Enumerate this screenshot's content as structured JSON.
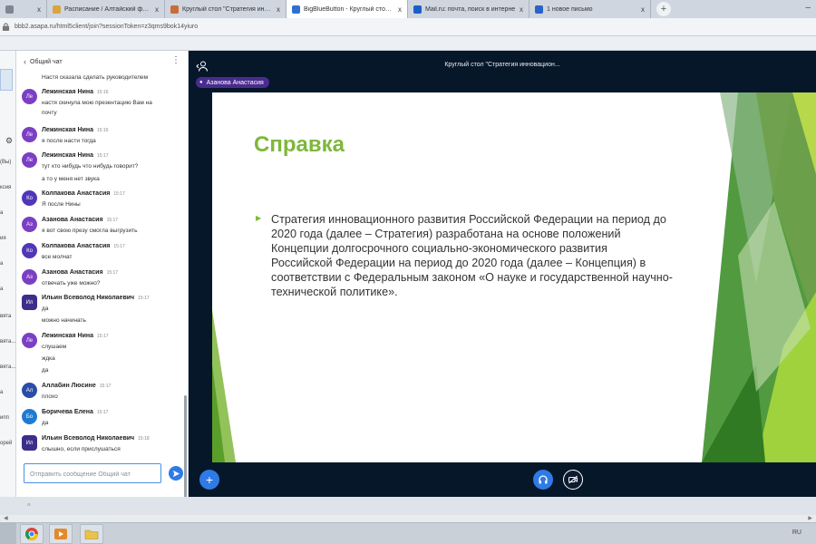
{
  "browser": {
    "tabs": [
      {
        "title": "",
        "color": "#7c8796",
        "active": false
      },
      {
        "title": "Расписание / Алтайский филиал",
        "color": "#d9a441",
        "active": false
      },
      {
        "title": "Круглый стол \"Стратегия иннова",
        "color": "#c96b3a",
        "active": false
      },
      {
        "title": "BigBlueButton - Круглый стол \"С",
        "color": "#2f6fd1",
        "active": true
      },
      {
        "title": "Mail.ru: почта, поиск в интерне",
        "color": "#1a5fc9",
        "active": false
      },
      {
        "title": "1 новое письмо",
        "color": "#2a63c8",
        "active": false
      }
    ],
    "tab_close": "x",
    "new_tab": "+",
    "window_controls": "–",
    "url": "bbb2.asapa.ru/html5client/join?sessionToken=z3qms9bok14yiuro"
  },
  "userlist": {
    "fragments": [
      "⚙",
      "(Вы)",
      "ксия",
      "а",
      "ия",
      "а",
      "а",
      "вята",
      "вята...",
      "вята...",
      "а",
      "ипп",
      "орей"
    ]
  },
  "chat": {
    "header": "Общий чат",
    "back_icon": "‹",
    "menu_icon": "⋮",
    "messages": [
      {
        "initials": "",
        "name": "",
        "time": "",
        "lines": [
          "Настя сказала сделать руководителем"
        ],
        "color": "#7b3fc4"
      },
      {
        "initials": "Ле",
        "name": "Лежинская Нина",
        "time": "15:16",
        "lines": [
          "настя скинула мою презентацию Вам на",
          "почту"
        ],
        "color": "#7b3fc4"
      },
      {
        "initials": "Ле",
        "name": "Лежинская Нина",
        "time": "15:16",
        "lines": [
          "я после насти тогда"
        ],
        "color": "#7b3fc4"
      },
      {
        "initials": "Ле",
        "name": "Лежинская Нина",
        "time": "15:17",
        "lines": [
          "тут кто нибудь что нибудь говорит?",
          "а то у меня нет звука"
        ],
        "color": "#7b3fc4"
      },
      {
        "initials": "Ко",
        "name": "Колпакова Анастасия",
        "time": "15:17",
        "lines": [
          "Я после Нины"
        ],
        "color": "#5236b8"
      },
      {
        "initials": "Аз",
        "name": "Азанова Анастасия",
        "time": "15:17",
        "lines": [
          "я вот свою презу смогла выгрузить"
        ],
        "color": "#7b3fc4"
      },
      {
        "initials": "Ко",
        "name": "Колпакова Анастасия",
        "time": "15:17",
        "lines": [
          "все молчат"
        ],
        "color": "#5236b8"
      },
      {
        "initials": "Аз",
        "name": "Азанова Анастасия",
        "time": "15:17",
        "lines": [
          "отвечать уже можно?"
        ],
        "color": "#7b3fc4"
      },
      {
        "initials": "Ил",
        "name": "Ильин Всеволод Николаевич",
        "time": "15:17",
        "lines": [
          "да",
          "можно начинать"
        ],
        "color": "#3b2f8a"
      },
      {
        "initials": "Ле",
        "name": "Лежинская Нина",
        "time": "15:17",
        "lines": [
          "слушаем",
          "ждка",
          "да"
        ],
        "color": "#7b3fc4"
      },
      {
        "initials": "Ал",
        "name": "Аллабин Люсине",
        "time": "15:17",
        "lines": [
          "плохо"
        ],
        "color": "#2a4da8"
      },
      {
        "initials": "Бо",
        "name": "Боричева Елена",
        "time": "15:17",
        "lines": [
          "да"
        ],
        "color": "#1f7bd1"
      },
      {
        "initials": "Ил",
        "name": "Ильин Всеволод Николаевич",
        "time": "15:18",
        "lines": [
          "слышно, если прислушаться"
        ],
        "color": "#3b2f8a"
      }
    ],
    "input_placeholder": "Отправить сообщение Общий чат"
  },
  "main": {
    "title": "Круглый стол \"Стратегия инновацион...",
    "talker": "Азанова Анастасия",
    "mic_icon": "●",
    "plus": "+",
    "slide": {
      "title": "Справка",
      "bullet": "▶",
      "text": "Стратегия инновационного развития Российской Федерации на период до\n2020 года (далее – Стратегия) разработана на основе положений\nКонцепции долгосрочного социально-экономического развития\nРоссийской Федерации на период до 2020 года (далее – Концепция) в\nсоответствии с Федеральным законом «О науке и государственной научно-\nтехнической политике».",
      "accent_color": "#7fb73c"
    }
  },
  "app_bottom": {
    "indicator": "^",
    "scroll_left": "◀",
    "scroll_right": "▶"
  },
  "taskbar": {
    "lang": "RU"
  }
}
